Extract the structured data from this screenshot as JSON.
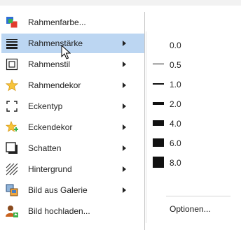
{
  "menu": {
    "items": [
      {
        "label": "Rahmenfarbe...",
        "icon": "color-squares-icon",
        "submenu": false
      },
      {
        "label": "Rahmenstärke",
        "icon": "line-weight-icon",
        "submenu": true,
        "active": true
      },
      {
        "label": "Rahmenstil",
        "icon": "frame-style-icon",
        "submenu": true
      },
      {
        "label": "Rahmendekor",
        "icon": "star-icon",
        "submenu": true
      },
      {
        "label": "Eckentyp",
        "icon": "corners-icon",
        "submenu": true
      },
      {
        "label": "Eckendekor",
        "icon": "star-plus-icon",
        "submenu": true
      },
      {
        "label": "Schatten",
        "icon": "shadow-box-icon",
        "submenu": true
      },
      {
        "label": "Hintergrund",
        "icon": "hatch-icon",
        "submenu": true
      },
      {
        "label": "Bild aus Galerie",
        "icon": "gallery-icon",
        "submenu": true
      },
      {
        "label": "Bild hochladen...",
        "icon": "upload-user-icon",
        "submenu": false
      }
    ]
  },
  "submenu": {
    "items": [
      {
        "label": "0.0"
      },
      {
        "label": "0.5"
      },
      {
        "label": "1.0"
      },
      {
        "label": "2.0"
      },
      {
        "label": "4.0"
      },
      {
        "label": "6.0"
      },
      {
        "label": "8.0"
      }
    ],
    "options_label": "Optionen..."
  },
  "colors": {
    "highlight": "#bcd6f2",
    "border": "#c8c8c8"
  }
}
